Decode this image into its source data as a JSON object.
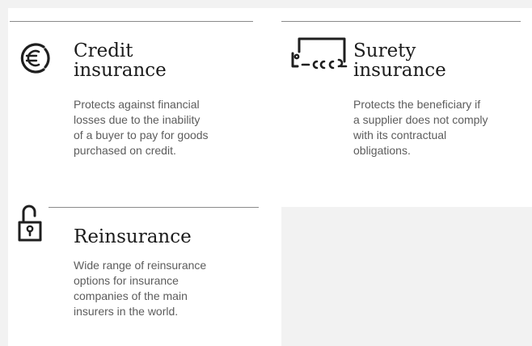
{
  "cards": [
    {
      "icon": "euro-icon",
      "title": "Credit\ninsurance",
      "description": "Protects against financial\nlosses due to the inability\nof a buyer to pay for goods\npurchased on credit."
    },
    {
      "icon": "surety-chain-icon",
      "title": "Surety\ninsurance",
      "description": "Protects the beneficiary if\na supplier does not comply\nwith its contractual\nobligations."
    },
    {
      "icon": "padlock-icon",
      "title": "Reinsurance",
      "description": "Wide range of reinsurance\noptions for insurance\ncompanies of the main\ninsurers in the world."
    }
  ],
  "colors": {
    "background": "#f2f2f2",
    "panel": "#ffffff",
    "title": "#1b1b1b",
    "description": "#5c5c5c",
    "rule": "#8a8a8a",
    "icon": "#1f1f1f"
  }
}
